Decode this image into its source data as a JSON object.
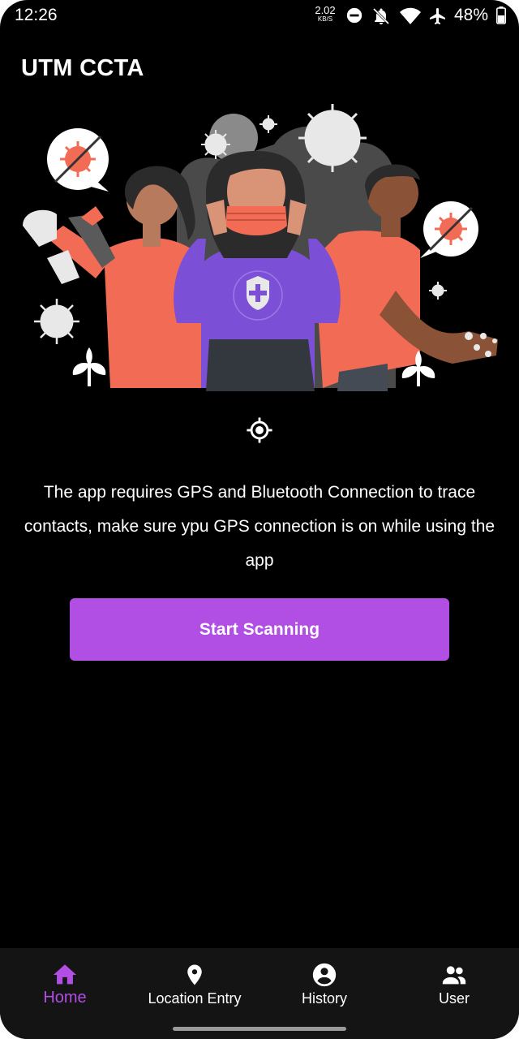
{
  "status_bar": {
    "time": "12:26",
    "net_speed_value": "2.02",
    "net_speed_unit": "KB/S",
    "battery_percent": "48%",
    "icons": [
      "do-not-disturb-icon",
      "notifications-off-icon",
      "wifi-icon",
      "airplane-icon",
      "battery-icon"
    ]
  },
  "app": {
    "title": "UTM CCTA"
  },
  "hero": {
    "icon": "people-wearing-masks-illustration"
  },
  "main": {
    "location_icon": "gps-fixed-icon",
    "info_text": "The app requires GPS and Bluetooth Connection to trace contacts, make sure ypu GPS connection is on while using the app",
    "scan_button_label": "Start Scanning"
  },
  "bottom_nav": {
    "items": [
      {
        "label": "Home",
        "icon": "home-icon",
        "active": true
      },
      {
        "label": "Location Entry",
        "icon": "location-pin-icon",
        "active": false
      },
      {
        "label": "History",
        "icon": "account-circle-icon",
        "active": false
      },
      {
        "label": "User",
        "icon": "group-icon",
        "active": false
      }
    ]
  },
  "colors": {
    "background": "#000000",
    "accent": "#b14ee4",
    "nav_background": "#141414",
    "illustration_coral": "#f26b55",
    "illustration_purple": "#7b4fd6"
  }
}
